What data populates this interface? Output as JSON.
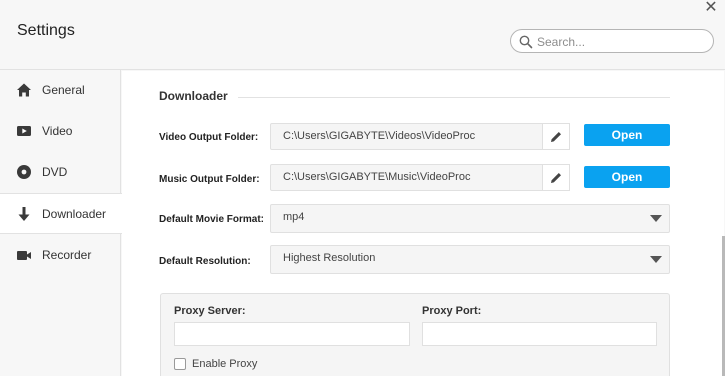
{
  "window": {
    "title": "Settings",
    "close_glyph": "✕"
  },
  "search": {
    "placeholder": "Search..."
  },
  "sidebar": {
    "items": [
      {
        "label": "General",
        "icon": "home-icon",
        "active": false
      },
      {
        "label": "Video",
        "icon": "video-icon",
        "active": false
      },
      {
        "label": "DVD",
        "icon": "disc-icon",
        "active": false
      },
      {
        "label": "Downloader",
        "icon": "download-icon",
        "active": true
      },
      {
        "label": "Recorder",
        "icon": "camera-icon",
        "active": false
      }
    ]
  },
  "downloader": {
    "section_title": "Downloader",
    "video_output": {
      "label": "Video Output Folder:",
      "value": "C:\\Users\\GIGABYTE\\Videos\\VideoProc",
      "open_label": "Open"
    },
    "music_output": {
      "label": "Music Output Folder:",
      "value": "C:\\Users\\GIGABYTE\\Music\\VideoProc",
      "open_label": "Open"
    },
    "movie_format": {
      "label": "Default Movie Format:",
      "value": "mp4"
    },
    "resolution": {
      "label": "Default Resolution:",
      "value": "Highest Resolution"
    },
    "proxy": {
      "server_label": "Proxy Server:",
      "server_value": "",
      "port_label": "Proxy Port:",
      "port_value": "",
      "enable_label": "Enable Proxy",
      "enabled": false
    }
  },
  "colors": {
    "accent": "#0aa2f0",
    "background": "#f7f7f7",
    "panel": "#ffffff"
  }
}
